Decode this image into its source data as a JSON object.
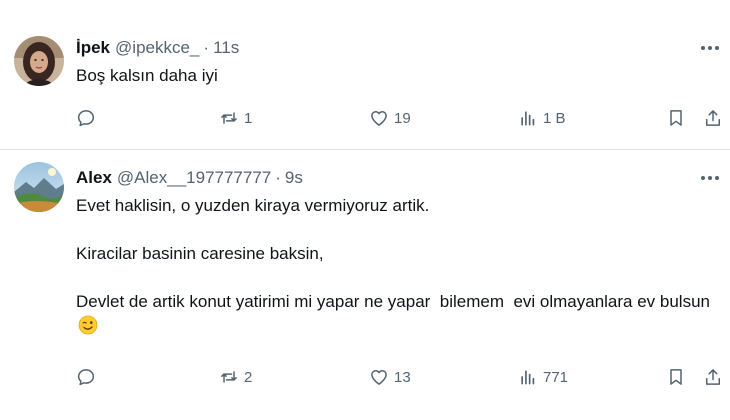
{
  "tweets": [
    {
      "name": "İpek",
      "handle": "@ipekkce_",
      "separator": "·",
      "time": "11s",
      "text": [
        "Boş kalsın daha iyi"
      ],
      "emoji": null,
      "counts": {
        "reply": "",
        "retweet": "1",
        "like": "19",
        "views": "1 B"
      }
    },
    {
      "name": "Alex",
      "handle": "@Alex__197777777",
      "separator": "·",
      "time": "9s",
      "text": [
        "Evet haklisin, o yuzden kiraya vermiyoruz artik.",
        "Kiracilar basinin caresine baksin,",
        "Devlet de artik konut yatirimi mi yapar ne yapar  bilemem  evi olmayanlara ev bulsun"
      ],
      "emoji": "winking-face-emoji",
      "counts": {
        "reply": "",
        "retweet": "2",
        "like": "13",
        "views": "771"
      }
    }
  ],
  "icons": {
    "reply": "reply-icon",
    "retweet": "retweet-icon",
    "like": "heart-icon",
    "views": "views-chart-icon",
    "bookmark": "bookmark-icon",
    "share": "share-icon",
    "more": "more-dots-icon"
  },
  "colors": {
    "text": "#0f1419",
    "secondary": "#536471",
    "divider": "#dfe3e7",
    "background": "#ffffff"
  }
}
